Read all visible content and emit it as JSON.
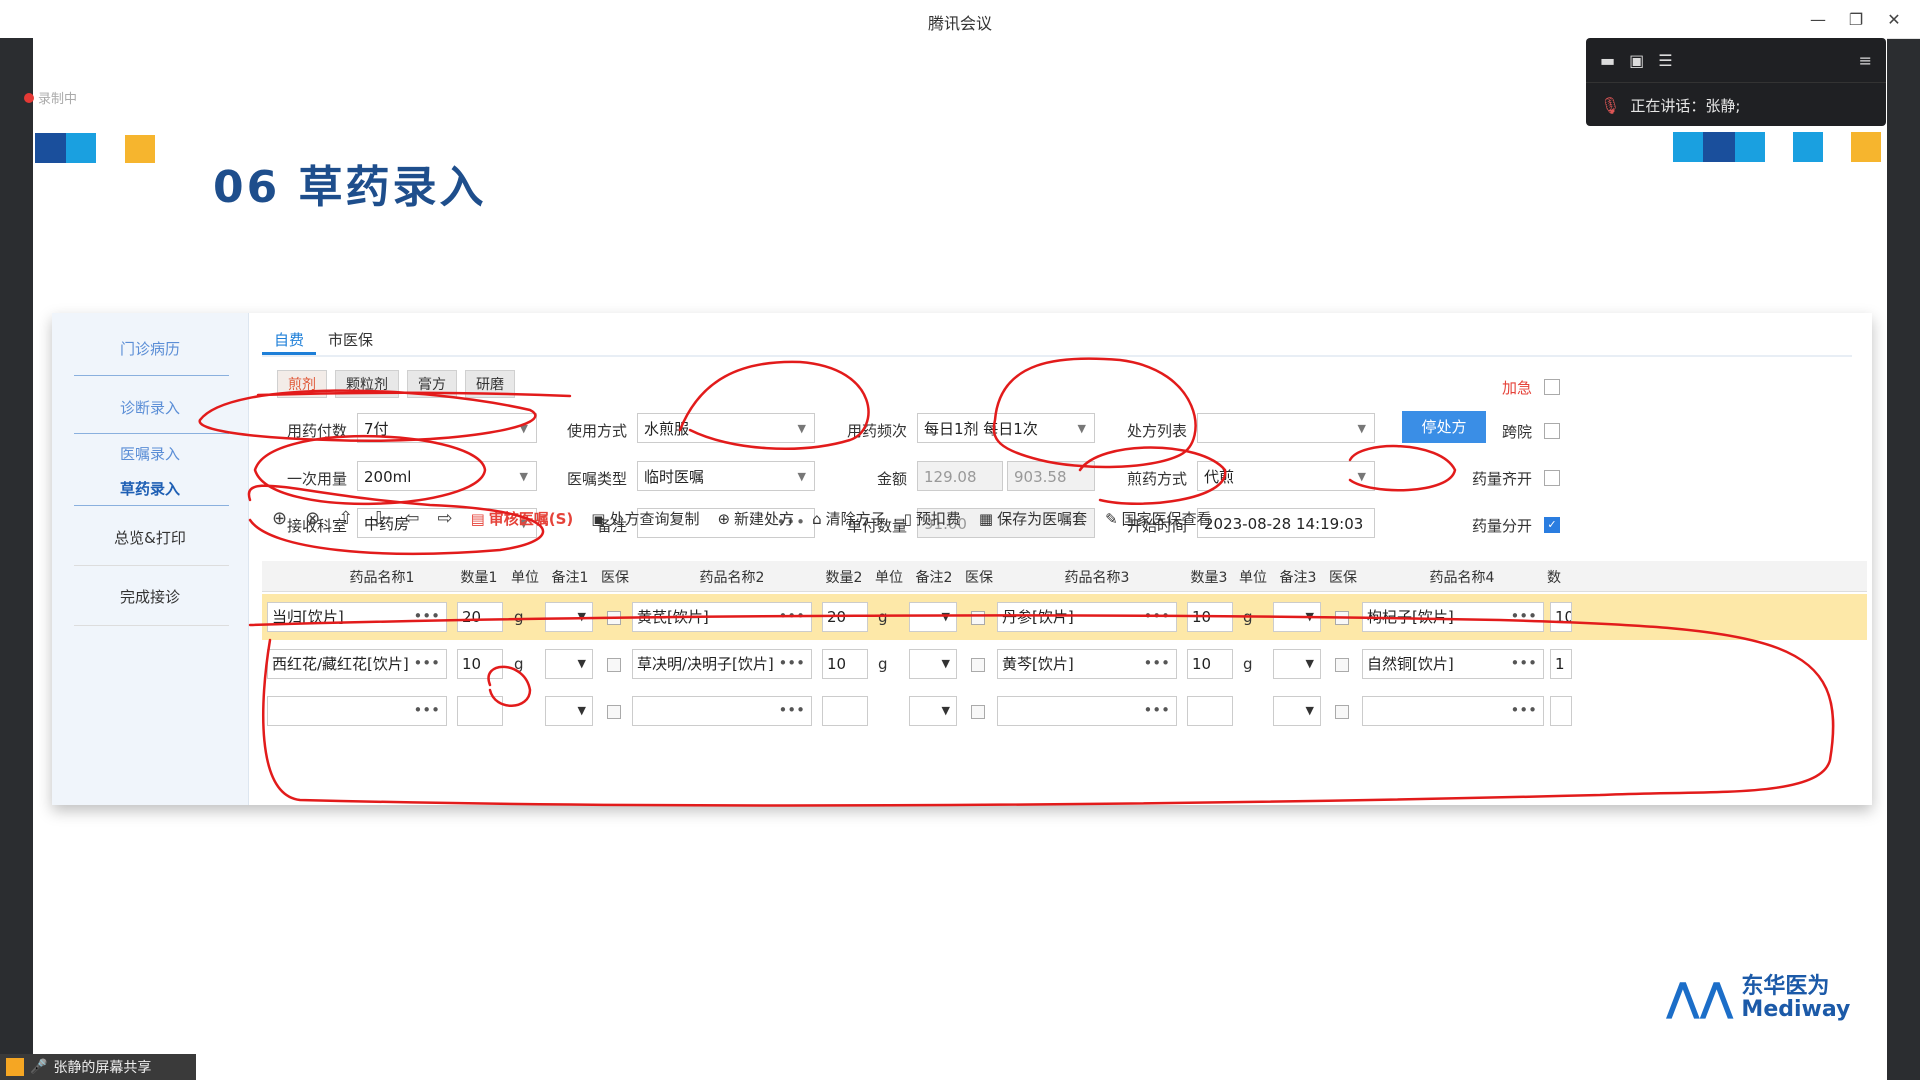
{
  "window": {
    "title": "腾讯会议",
    "minimize": "—",
    "restore": "❐",
    "close": "✕"
  },
  "recording": {
    "label": "录制中"
  },
  "speaker_panel": {
    "speaking_label": "正在讲话：张静;"
  },
  "slide": {
    "title": "06 草药录入",
    "colors": {
      "dark_blue": "#1a4f9c",
      "light_blue": "#1aa0e0",
      "yellow": "#f6b52e"
    }
  },
  "logo": {
    "cn": "东华医为",
    "en": "Mediway"
  },
  "bottom_bar": {
    "label": "张静的屏幕共享"
  },
  "app": {
    "sidebar": [
      {
        "label": "门诊病历"
      },
      {
        "label": "诊断录入"
      },
      {
        "label": "医嘱录入"
      },
      {
        "label": "草药录入"
      },
      {
        "label": "总览&打印"
      },
      {
        "label": "完成接诊"
      }
    ],
    "tabs": [
      {
        "label": "自费"
      },
      {
        "label": "市医保"
      }
    ],
    "subtabs": [
      {
        "label": "煎剂"
      },
      {
        "label": "颗粒剂"
      },
      {
        "label": "膏方"
      },
      {
        "label": "研磨"
      }
    ],
    "form": {
      "dose_count_label": "用药付数",
      "dose_count": "7付",
      "single_amount_label": "一次用量",
      "single_amount": "200ml",
      "recv_dept_label": "接收科室",
      "recv_dept": "中药房",
      "usage_label": "使用方式",
      "usage": "水煎服",
      "order_type_label": "医嘱类型",
      "order_type": "临时医嘱",
      "remark_label": "备注",
      "remark": "",
      "freq_label": "用药频次",
      "freq": "每日1剂 每日1次",
      "amount_label": "金额",
      "amount1": "129.08",
      "amount2": "903.58",
      "unit_qty_label": "单付数量",
      "unit_qty": "91.00",
      "rx_list_label": "处方列表",
      "rx_list": "",
      "decoct_label": "煎药方式",
      "decoct": "代煎",
      "start_time_label": "开始时间",
      "start_time": "2023-08-28 14:19:03",
      "stop_rx_button": "停处方",
      "urgent_label": "加急",
      "cross_label": "跨院",
      "qty_together_label": "药量齐开",
      "qty_split_label": "药量分开"
    },
    "toolbar": {
      "audit": "审核医嘱(S)",
      "rx_copy": "处方查询复制",
      "new_rx": "新建处方",
      "clear": "清除方子",
      "prepay": "预扣费",
      "save_set": "保存为医嘱套",
      "insurance": "国家医保查看"
    },
    "grid": {
      "headers": [
        "药品名称1",
        "数量1",
        "单位",
        "备注1",
        "医保",
        "药品名称2",
        "数量2",
        "单位",
        "备注2",
        "医保",
        "药品名称3",
        "数量3",
        "单位",
        "备注3",
        "医保",
        "药品名称4",
        "数"
      ],
      "rows": [
        {
          "n1": "当归[饮片]",
          "q1": "20",
          "u1": "g",
          "n2": "黄芪[饮片]",
          "q2": "20",
          "u2": "g",
          "n3": "丹参[饮片]",
          "q3": "10",
          "u3": "g",
          "n4": "枸杞子[饮片]",
          "q4": "10"
        },
        {
          "n1": "西红花/藏红花[饮片]",
          "q1": "10",
          "u1": "g",
          "n2": "草决明/决明子[饮片]",
          "q2": "10",
          "u2": "g",
          "n3": "黄芩[饮片]",
          "q3": "10",
          "u3": "g",
          "n4": "自然铜[饮片]",
          "q4": "1"
        },
        {
          "n1": "",
          "q1": "",
          "u1": "",
          "n2": "",
          "q2": "",
          "u2": "",
          "n3": "",
          "q3": "",
          "u3": "",
          "n4": "",
          "q4": ""
        }
      ]
    }
  }
}
